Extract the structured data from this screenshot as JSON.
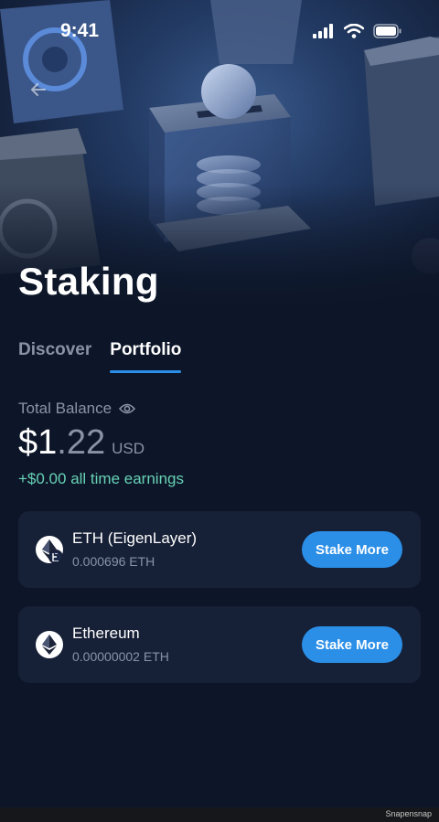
{
  "status_bar": {
    "time": "9:41"
  },
  "page": {
    "title": "Staking"
  },
  "tabs": [
    {
      "label": "Discover",
      "active": false
    },
    {
      "label": "Portfolio",
      "active": true
    }
  ],
  "balance": {
    "label": "Total Balance",
    "whole": "$1",
    "cents": ".22",
    "currency": "USD",
    "earnings": "+$0.00 all time earnings"
  },
  "positions": [
    {
      "name": "ETH (EigenLayer)",
      "amount": "0.000696 ETH",
      "button": "Stake More",
      "icon": "ethereum-icon",
      "badge": "eigenlayer-badge-icon"
    },
    {
      "name": "Ethereum",
      "amount": "0.00000002 ETH",
      "button": "Stake More",
      "icon": "ethereum-icon"
    }
  ],
  "watermark": "Snapensnap",
  "colors": {
    "accent": "#2b8fe8",
    "earnings": "#67d1b5",
    "background": "#0d1628",
    "card": "#162036"
  }
}
